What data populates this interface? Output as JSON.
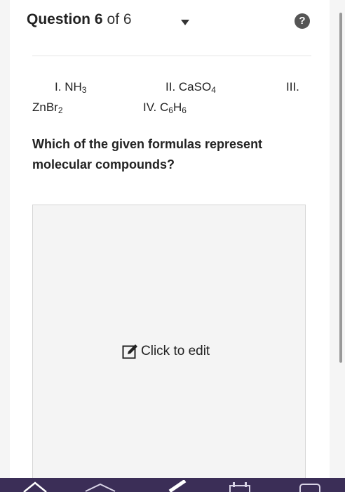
{
  "header": {
    "question_label": "Question 6",
    "question_of": "of 6"
  },
  "icons": {
    "help": "question-circle-icon",
    "dropdown": "caret-down-icon",
    "edit": "edit-icon"
  },
  "formulas": {
    "item1": {
      "numeral": "I.",
      "symbol": "NH",
      "sub": "3"
    },
    "item2": {
      "numeral": "II.",
      "symbol_a": "CaSO",
      "sub": "4"
    },
    "item3": {
      "numeral": "III.",
      "symbol": "ZnBr",
      "sub": "2"
    },
    "item4": {
      "numeral": "IV.",
      "sym_a": "C",
      "sub_a": "6",
      "sym_b": "H",
      "sub_b": "6"
    }
  },
  "question": {
    "text": "Which of the given formulas represent molecular compounds?"
  },
  "answer": {
    "edit_label": "Click to edit"
  },
  "help": {
    "glyph": "?"
  },
  "colors": {
    "bottom_bar": "#3b2e57",
    "answer_bg": "#f4f4f4"
  }
}
